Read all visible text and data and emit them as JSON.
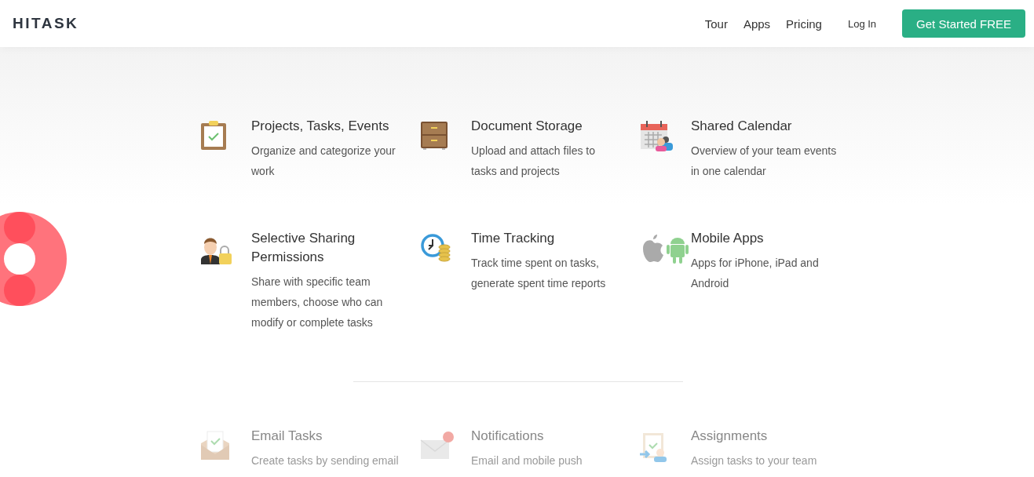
{
  "header": {
    "logo": "HITASK",
    "nav": [
      {
        "label": "Tour"
      },
      {
        "label": "Apps"
      },
      {
        "label": "Pricing"
      }
    ],
    "login": "Log In",
    "cta": "Get Started FREE"
  },
  "feature_groups": [
    {
      "rows": [
        [
          {
            "title": "Projects, Tasks, Events",
            "description": "Organize and categorize your work",
            "faded": false
          },
          {
            "title": "Document Storage",
            "description": "Upload and attach files to tasks and projects",
            "faded": false
          },
          {
            "title": "Shared Calendar",
            "description": "Overview of your team events in one calendar",
            "faded": false
          }
        ],
        [
          {
            "title": "Selective Sharing Permissions",
            "description": "Share with specific team members, choose who can modify or complete tasks",
            "faded": false
          },
          {
            "title": "Time Tracking",
            "description": "Track time spent on tasks, generate spent time reports",
            "faded": false
          },
          {
            "title": "Mobile Apps",
            "description": "Apps for iPhone, iPad and Android",
            "faded": false
          }
        ]
      ]
    },
    {
      "rows": [
        [
          {
            "title": "Email Tasks",
            "description": "Create tasks by sending email",
            "faded": true
          },
          {
            "title": "Notifications",
            "description": "Email and mobile push",
            "faded": true
          },
          {
            "title": "Assignments",
            "description": "Assign tasks to your team",
            "faded": true
          }
        ]
      ]
    }
  ]
}
